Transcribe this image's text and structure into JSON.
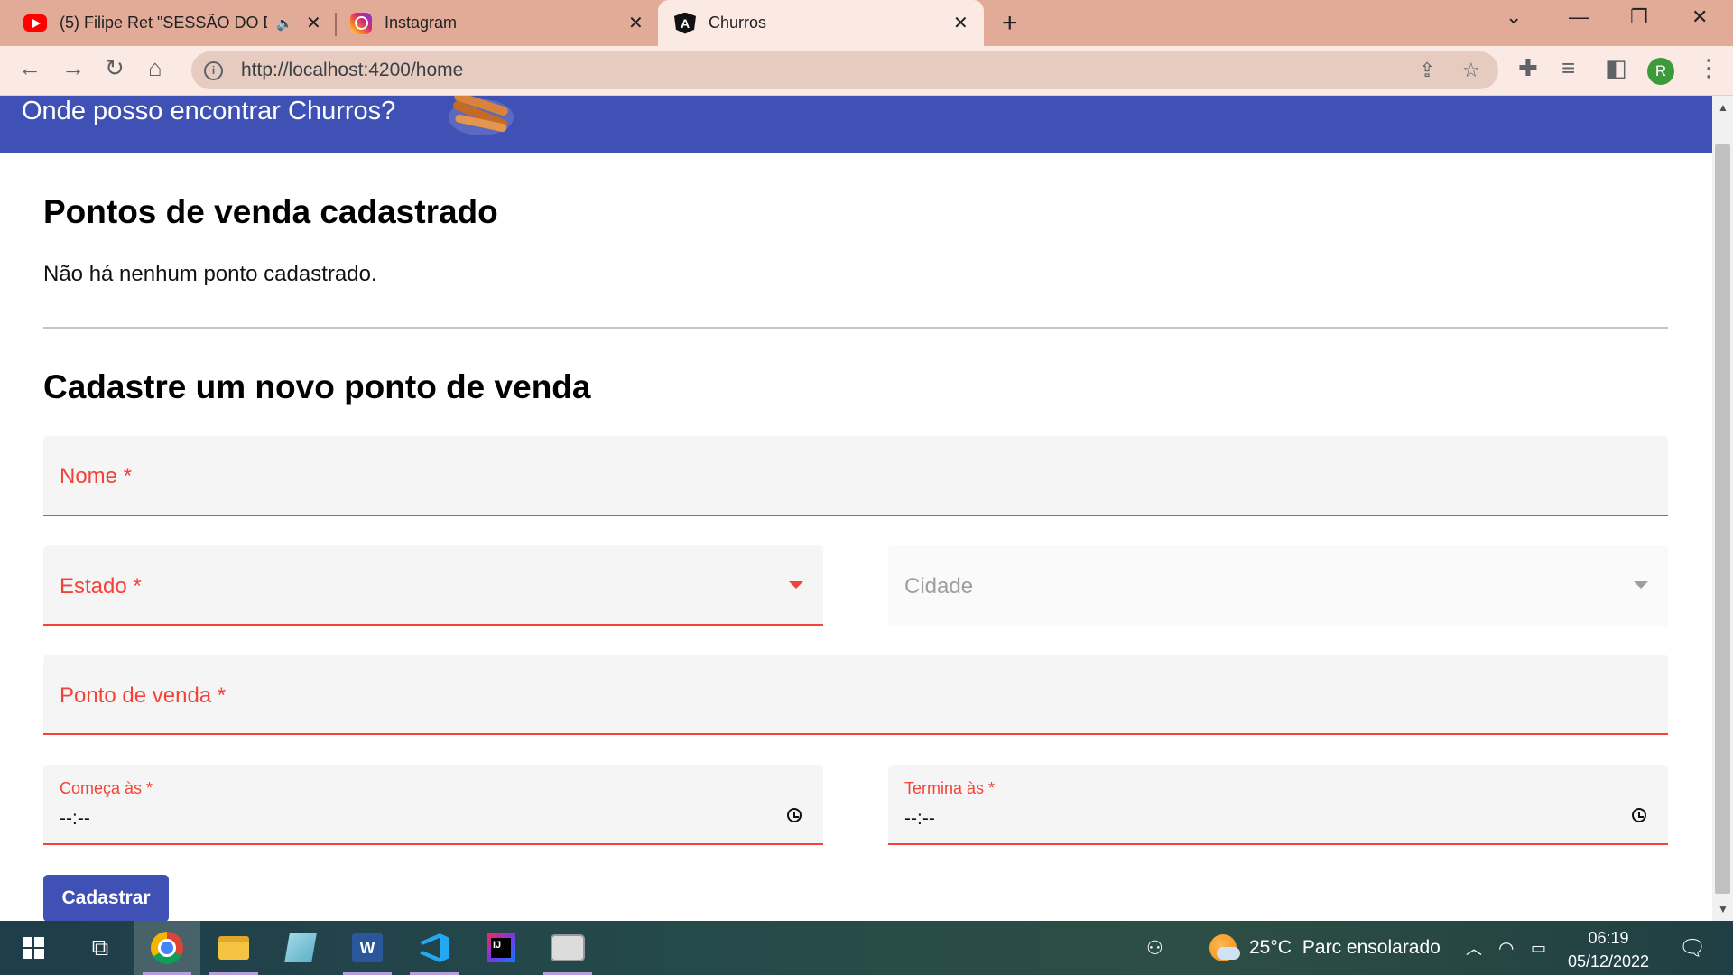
{
  "browser": {
    "tabs": [
      {
        "title": "(5) Filipe Ret \"SESSÃO DO DE",
        "favicon": "youtube-icon",
        "audio": true
      },
      {
        "title": "Instagram",
        "favicon": "instagram-icon"
      },
      {
        "title": "Churros",
        "favicon": "angular-icon",
        "active": true
      }
    ],
    "url": "http://localhost:4200/home",
    "profile_initial": "R"
  },
  "app": {
    "title": "Onde posso encontrar Churros?",
    "header_color": "#3f51b5"
  },
  "list_section": {
    "heading": "Pontos de venda cadastrado",
    "empty_message": "Não há nenhum ponto cadastrado."
  },
  "form": {
    "heading": "Cadastre um novo ponto de venda",
    "name_label": "Nome *",
    "state_label": "Estado *",
    "city_label": "Cidade",
    "sale_point_label": "Ponto de venda *",
    "start_label": "Começa às *",
    "start_value": "--:--",
    "end_label": "Termina às *",
    "end_value": "--:--",
    "submit_label": "Cadastrar",
    "error_color": "#f44336"
  },
  "taskbar": {
    "weather_temp": "25°C",
    "weather_desc": "Parc ensolarado",
    "time": "06:19",
    "date": "05/12/2022",
    "apps": [
      "start-icon",
      "task-view-icon",
      "chrome-icon",
      "file-explorer-icon",
      "notepad-icon",
      "word-icon",
      "vscode-icon",
      "intellij-icon",
      "cat-app-icon"
    ]
  }
}
